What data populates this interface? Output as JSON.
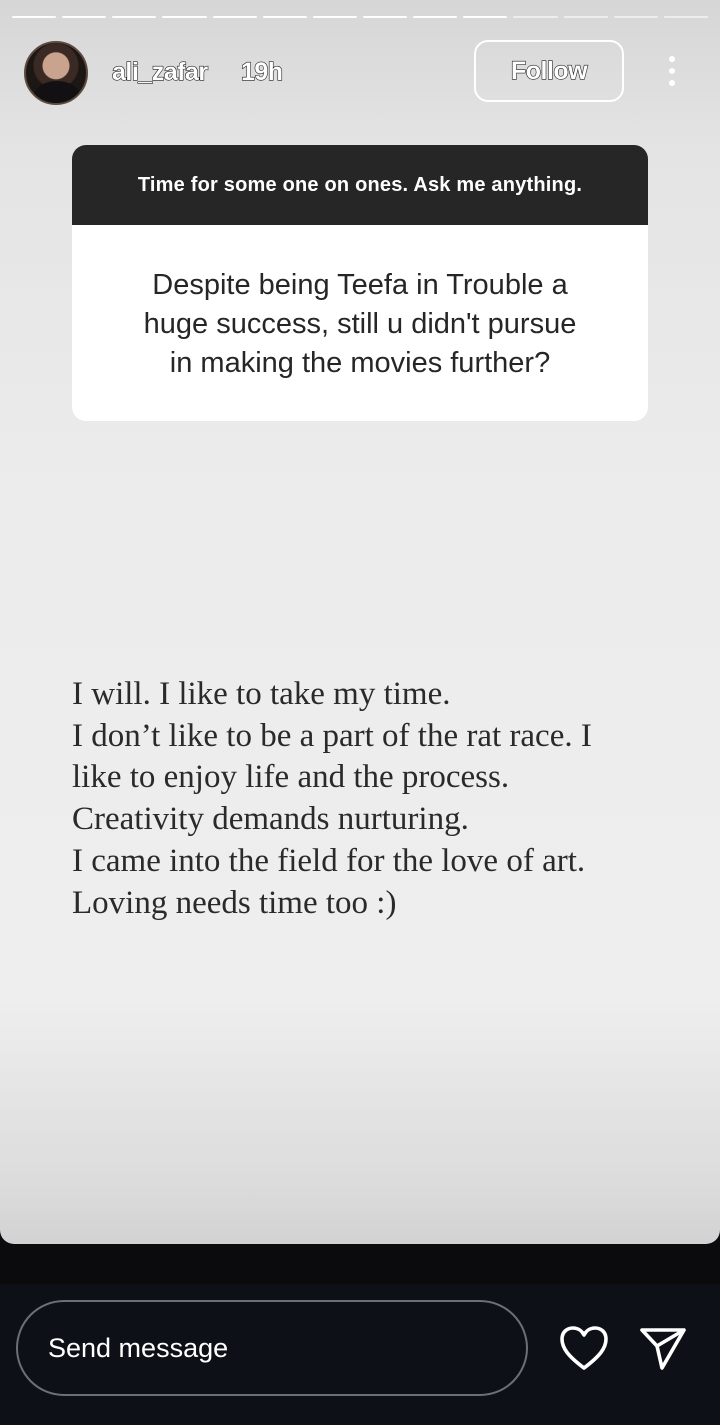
{
  "header": {
    "username": "ali_zafar",
    "time_ago": "19h",
    "follow_label": "Follow",
    "icons": {
      "avatar": "profile-photo",
      "more": "more-options-icon"
    }
  },
  "progress": {
    "segments": 14,
    "viewed": 10
  },
  "question_box": {
    "prompt": "Time for some one on ones. Ask me anything.",
    "question_lines": [
      "Despite being Teefa in Trouble a",
      "huge success, still u didn't pursue",
      "in making the movies further?"
    ]
  },
  "answer": {
    "lines": [
      "I will. I like to take my time.",
      "I don’t like to be a part of the rat race. I",
      "like to enjoy life and the process.",
      "Creativity demands nurturing.",
      "I came into the field for the love of art.",
      "Loving needs time too :)"
    ]
  },
  "reply_bar": {
    "placeholder": "Send message",
    "icons": {
      "like": "heart-icon",
      "share": "send-icon"
    }
  },
  "colors": {
    "question_header_bg": "#262626",
    "question_body_bg": "#ffffff",
    "bottom_bar_bg": "#0d1117"
  }
}
